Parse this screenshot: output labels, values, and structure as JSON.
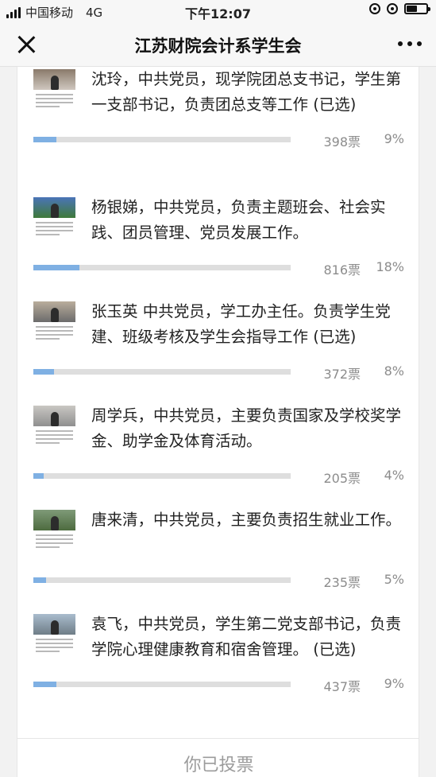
{
  "status_bar": {
    "carrier": "中国移动",
    "network": "4G",
    "time": "下午12:07"
  },
  "nav": {
    "title": "江苏财院会计系学生会"
  },
  "candidates": [
    {
      "description": "沈玲，中共党员，现学院团总支书记，学生第一支部书记，负责团总支等工作 (已选)",
      "votes": "398票",
      "percent": "9%",
      "share": 0.09,
      "photo_colors": [
        "#8a7a6a",
        "#cfc7bf"
      ]
    },
    {
      "description": "杨银娣，中共党员，负责主题班会、社会实践、团员管理、党员发展工作。",
      "votes": "816票",
      "percent": "18%",
      "share": 0.18,
      "photo_colors": [
        "#4a74b8",
        "#3f7a3a"
      ]
    },
    {
      "description": "张玉英 中共党员，学工办主任。负责学生党建、班级考核及学生会指导工作 (已选)",
      "votes": "372票",
      "percent": "8%",
      "share": 0.08,
      "photo_colors": [
        "#b9ad9c",
        "#6b6b6b"
      ]
    },
    {
      "description": "周学兵，中共党员，主要负责国家及学校奖学金、助学金及体育活动。",
      "votes": "205票",
      "percent": "4%",
      "share": 0.04,
      "photo_colors": [
        "#c9c7c3",
        "#8f8f8f"
      ]
    },
    {
      "description": "唐来清，中共党员，主要负责招生就业工作。",
      "votes": "235票",
      "percent": "5%",
      "share": 0.05,
      "photo_colors": [
        "#7f9a78",
        "#4d6b3f"
      ]
    },
    {
      "description": "袁飞，中共党员，学生第二党支部书记，负责学院心理健康教育和宿舍管理。 (已选)",
      "votes": "437票",
      "percent": "9%",
      "share": 0.09,
      "photo_colors": [
        "#a9bccd",
        "#6f7d87"
      ]
    }
  ],
  "footer": {
    "label": "你已投票"
  },
  "colors": {
    "bar_fill": "#7fb0e3",
    "bar_track": "#dedede"
  }
}
